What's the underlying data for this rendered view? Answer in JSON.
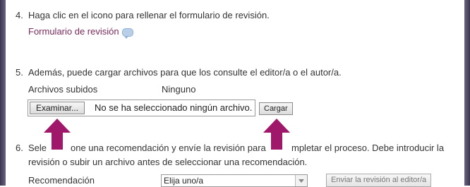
{
  "step4": {
    "number": "4.",
    "text": "Haga clic en el icono para rellenar el formulario de revisión.",
    "link": "Formulario de revisión",
    "icon": "comment-icon"
  },
  "step5": {
    "number": "5.",
    "text": "Además, puede cargar archivos para que los consulte el editor/a o el autor/a.",
    "files_label": "Archivos subidos",
    "files_value": "Ninguno",
    "browse_label": "Examinar...",
    "file_status": "No se ha seleccionado ningún archivo.",
    "upload_label": "Cargar"
  },
  "step6": {
    "number": "6.",
    "line1_left": "Sele",
    "line1_mid": "one una recomendación y envíe la revisión para",
    "line1_right": "mpletar el proceso. Debe introducir la",
    "line2": "revisión o subir un archivo antes de seleccionar una recomendación.",
    "recommendation_label": "Recomendación",
    "select_value": "Elija uno/a",
    "submit_label": "Enviar la revisión al editor/a"
  },
  "colors": {
    "arrow": "#a0186a",
    "link": "#7a2a5e"
  }
}
